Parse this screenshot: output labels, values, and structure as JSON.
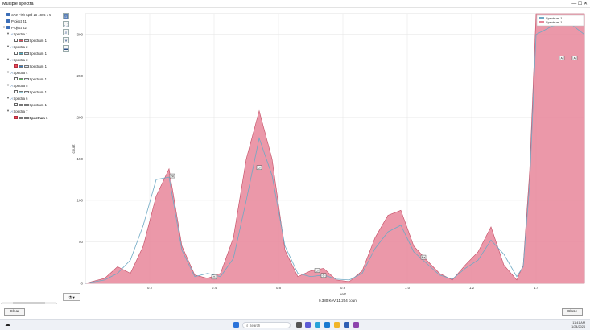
{
  "window": {
    "title": "Multiple spectra",
    "controls": "— ☐ ✕"
  },
  "tree": {
    "root_items": [
      "SAe Fish April 15 1894 k  s",
      "Project 41",
      "Project 42"
    ],
    "spectra": [
      {
        "label": "Spectra 1",
        "child": "Spectrum 1",
        "color": "#e74c5c",
        "checked": false
      },
      {
        "label": "Spectra 2",
        "child": "Spectrum 1",
        "color": "#4ab0c8",
        "checked": false
      },
      {
        "label": "Spectra 3",
        "child": "Spectrum 1",
        "color": "#3b7fc4",
        "checked": true
      },
      {
        "label": "Spectra 4",
        "child": "Spectrum 1",
        "color": "#5ab85a",
        "checked": false
      },
      {
        "label": "Spectra 5",
        "child": "Spectrum 1",
        "color": "#8fc7d4",
        "checked": false
      },
      {
        "label": "Spectra 6",
        "child": "Spectrum 1",
        "color": "#e74c5c",
        "checked": false
      },
      {
        "label": "Spectra 7",
        "child": "Spectrum 1",
        "color": "#e74c5c",
        "checked": true,
        "bold": true
      }
    ]
  },
  "toolbar": {
    "tools": [
      "pointer-tool",
      "zoom-box-tool",
      "zoom-tool",
      "filter-tool",
      "display-tool"
    ]
  },
  "chart_data": {
    "type": "area",
    "xlabel": "keV",
    "ylabel": "count",
    "xlim": [
      0.0,
      1.55
    ],
    "ylim": [
      0,
      325
    ],
    "x_ticks": [
      "0.2",
      "0.4",
      "0.6",
      "0.8",
      "1.0",
      "1.2",
      "1.4"
    ],
    "y_ticks": [
      "0",
      "50",
      "100",
      "150",
      "200",
      "250",
      "300"
    ],
    "grid": true,
    "legend_position": "top-right",
    "series": [
      {
        "name": "Spectrum 1",
        "style": "line",
        "color": "#6fa9c4",
        "x": [
          0.0,
          0.06,
          0.1,
          0.14,
          0.18,
          0.22,
          0.26,
          0.3,
          0.34,
          0.38,
          0.42,
          0.46,
          0.5,
          0.54,
          0.58,
          0.62,
          0.66,
          0.7,
          0.74,
          0.78,
          0.82,
          0.86,
          0.9,
          0.94,
          0.98,
          1.02,
          1.06,
          1.1,
          1.14,
          1.18,
          1.22,
          1.26,
          1.3,
          1.34,
          1.36,
          1.38,
          1.4,
          1.45,
          1.5,
          1.55
        ],
        "y": [
          0,
          4,
          12,
          28,
          70,
          125,
          128,
          40,
          8,
          12,
          8,
          30,
          100,
          175,
          130,
          45,
          12,
          8,
          10,
          5,
          4,
          12,
          42,
          62,
          70,
          38,
          24,
          10,
          5,
          18,
          28,
          52,
          35,
          8,
          20,
          120,
          300,
          310,
          315,
          300
        ]
      },
      {
        "name": "Spectrum 1",
        "style": "filled",
        "color": "#e8869a",
        "x": [
          0.0,
          0.06,
          0.1,
          0.14,
          0.18,
          0.22,
          0.26,
          0.3,
          0.34,
          0.38,
          0.42,
          0.46,
          0.5,
          0.54,
          0.58,
          0.62,
          0.66,
          0.7,
          0.74,
          0.78,
          0.82,
          0.86,
          0.9,
          0.94,
          0.98,
          1.02,
          1.06,
          1.1,
          1.14,
          1.18,
          1.22,
          1.26,
          1.3,
          1.34,
          1.36,
          1.38,
          1.4,
          1.45,
          1.5,
          1.55
        ],
        "y": [
          0,
          6,
          20,
          12,
          45,
          105,
          138,
          45,
          10,
          6,
          12,
          55,
          150,
          208,
          150,
          40,
          8,
          15,
          18,
          4,
          2,
          15,
          55,
          82,
          88,
          45,
          28,
          12,
          4,
          22,
          38,
          68,
          22,
          4,
          22,
          135,
          325,
          325,
          325,
          325
        ]
      }
    ],
    "peak_markers": [
      {
        "label": "Ni",
        "x": 0.27,
        "y": 128
      },
      {
        "label": "Cr",
        "x": 0.54,
        "y": 138
      },
      {
        "label": "O",
        "x": 0.4,
        "y": 6
      },
      {
        "label": "Cr",
        "x": 0.72,
        "y": 14
      },
      {
        "label": "O",
        "x": 0.74,
        "y": 8
      },
      {
        "label": "Na",
        "x": 1.05,
        "y": 30
      },
      {
        "label": "Al",
        "x": 1.48,
        "y": 270
      },
      {
        "label": "Al",
        "x": 1.52,
        "y": 270
      }
    ]
  },
  "peak_button": {
    "label": "⚗ ▾"
  },
  "cursor_readout": "0.380 KeV  11.204 count",
  "buttons": {
    "clear": "Clear",
    "close": "Close"
  },
  "taskbar": {
    "search_placeholder": "Search",
    "time": "11:41 AM",
    "date": "1/24/2024"
  }
}
